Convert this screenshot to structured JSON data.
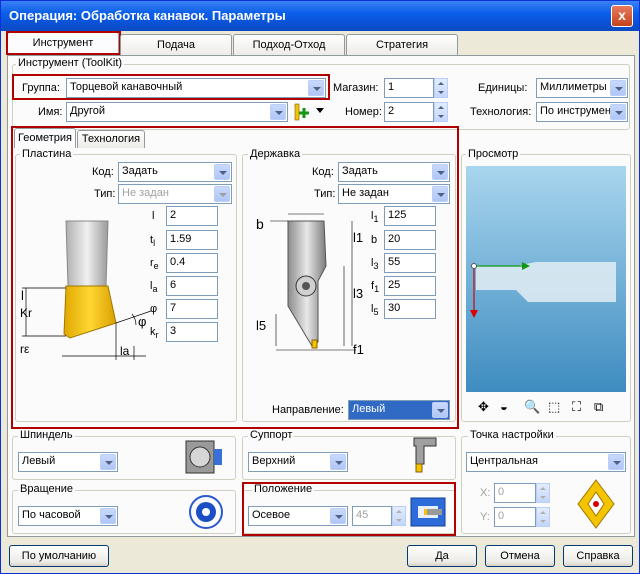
{
  "window": {
    "title": "Операция: Обработка канавок. Параметры",
    "close": "x"
  },
  "tabs": [
    "Инструмент",
    "Подача",
    "Подход-Отход",
    "Стратегия"
  ],
  "toolkit": {
    "legend": "Инструмент (ToolKit)",
    "group_label": "Группа:",
    "group_value": "Торцевой канавочный",
    "name_label": "Имя:",
    "name_value": "Другой",
    "magazine_label": "Магазин:",
    "magazine_value": "1",
    "number_label": "Номер:",
    "number_value": "2",
    "units_label": "Единицы:",
    "units_value": "Миллиметры",
    "technology_label": "Технология:",
    "technology_value": "По инструмент"
  },
  "subtabs": [
    "Геометрия",
    "Технология"
  ],
  "plate": {
    "legend": "Пластина",
    "code_label": "Код:",
    "code_value": "Задать",
    "type_label": "Тип:",
    "type_value": "Не задан",
    "params": [
      {
        "sym": "l",
        "sub": "",
        "value": "2"
      },
      {
        "sym": "t",
        "sub": "l",
        "value": "1.59"
      },
      {
        "sym": "r",
        "sub": "e",
        "value": "0.4"
      },
      {
        "sym": "l",
        "sub": "a",
        "value": "6"
      },
      {
        "sym": "φ",
        "sub": "",
        "value": "7"
      },
      {
        "sym": "k",
        "sub": "r",
        "value": "3"
      }
    ],
    "diagram_labels": {
      "l": "l",
      "kr": "Kr",
      "re": "rε",
      "la": "la",
      "phi": "φ"
    }
  },
  "holder": {
    "legend": "Державка",
    "code_label": "Код:",
    "code_value": "Задать",
    "type_label": "Тип:",
    "type_value": "Не задан",
    "params": [
      {
        "sym": "l",
        "sub": "1",
        "value": "125"
      },
      {
        "sym": "b",
        "sub": "",
        "value": "20"
      },
      {
        "sym": "l",
        "sub": "3",
        "value": "55"
      },
      {
        "sym": "f",
        "sub": "1",
        "value": "25"
      },
      {
        "sym": "l",
        "sub": "5",
        "value": "30"
      }
    ],
    "direction_label": "Направление:",
    "direction_value": "Левый",
    "diagram_labels": {
      "b": "b",
      "l1": "l1",
      "l3": "l3",
      "l5": "l5",
      "f1": "f1"
    }
  },
  "preview": {
    "legend": "Просмотр"
  },
  "spindle": {
    "legend": "Шпиндель",
    "value": "Левый"
  },
  "rotation": {
    "legend": "Вращение",
    "value": "По часовой"
  },
  "support": {
    "legend": "Суппорт",
    "value": "Верхний"
  },
  "position": {
    "legend": "Положение",
    "value": "Осевое",
    "angle": "45"
  },
  "setpoint": {
    "legend": "Точка настройки",
    "value": "Центральная",
    "x_label": "X:",
    "x_value": "0",
    "y_label": "Y:",
    "y_value": "0"
  },
  "buttons": {
    "default": "По умолчанию",
    "ok": "Да",
    "cancel": "Отмена",
    "help": "Справка"
  },
  "colors": {
    "title_bar": "#0A53D8",
    "highlight": "#B00000",
    "insert": "#F5C400",
    "preview_bg": "#4F9CC8"
  }
}
